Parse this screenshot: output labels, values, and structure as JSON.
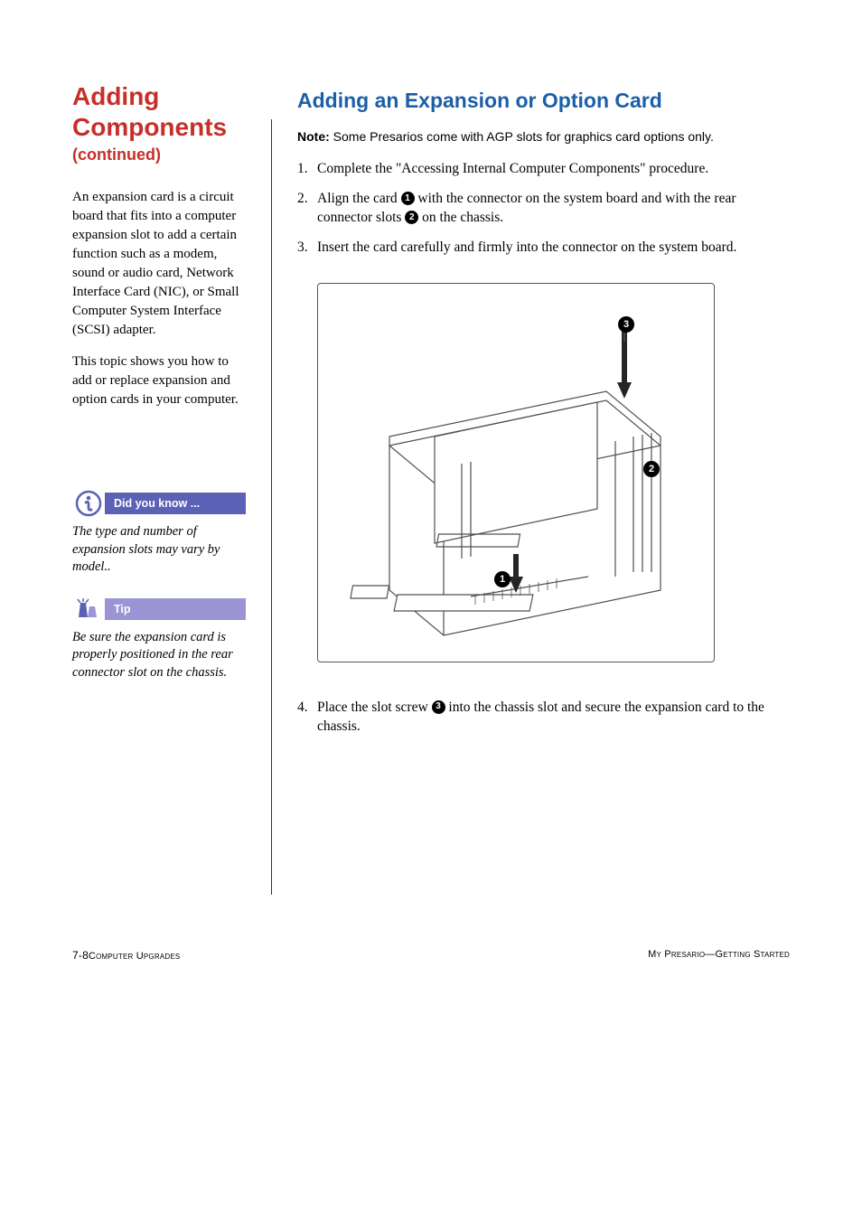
{
  "left": {
    "title": "Adding Components",
    "continued": "(continued)",
    "para1": "An expansion card is a circuit board that fits into a computer expansion slot to add a certain function such as a modem, sound or audio card, Network Interface Card (NIC), or Small Computer System Interface (SCSI) adapter.",
    "para2": "This topic shows you how to add or replace expansion and option cards in your computer."
  },
  "didyouknow": {
    "header": "Did you know ...",
    "body": "The type and number of expansion slots may vary by model.."
  },
  "tip": {
    "header": "Tip",
    "body": "Be sure the expansion card is properly positioned in the rear connector slot on the chassis."
  },
  "right": {
    "section_title": "Adding an Expansion or Option Card",
    "note_label": "Note:",
    "note_text": " Some Presarios come with AGP slots for graphics card options only.",
    "step1": "Complete the \"Accessing Internal Computer Components\" procedure.",
    "step2_a": "Align the card ",
    "step2_b": " with the connector on the system board and with the rear connector slots ",
    "step2_c": " on the chassis.",
    "step3": "Insert the card carefully and firmly into the connector on the system board.",
    "step4_a": "Place the slot screw ",
    "step4_b": " into the chassis slot and secure the expansion card to the chassis.",
    "numbers": {
      "n1": "1",
      "n2": "2",
      "n3": "3"
    }
  },
  "illustration": {
    "labels": {
      "l1": "1",
      "l2": "2",
      "l3": "3"
    }
  },
  "footer": {
    "page": "7-8",
    "left": "  Computer Upgrades",
    "right": "My Presario—Getting Started"
  }
}
